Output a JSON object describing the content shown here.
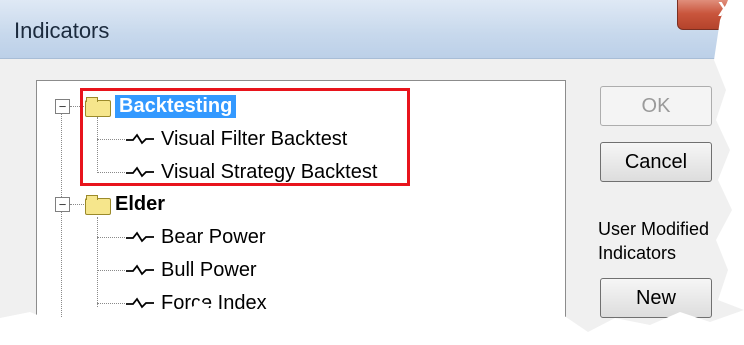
{
  "window": {
    "title": "Indicators",
    "close_glyph": "X"
  },
  "tree": {
    "groups": [
      {
        "label": "Backtesting",
        "expander": "−",
        "selected": true,
        "items": [
          "Visual Filter Backtest",
          "Visual Strategy Backtest"
        ]
      },
      {
        "label": "Elder",
        "expander": "−",
        "selected": false,
        "items": [
          "Bear Power",
          "Bull Power",
          "Force Index"
        ]
      }
    ]
  },
  "buttons": {
    "ok": "OK",
    "cancel": "Cancel",
    "new": "New"
  },
  "user_modified_label": "User Modified Indicators",
  "colors": {
    "selection": "#3399ff",
    "highlight_box": "#e8141c"
  }
}
